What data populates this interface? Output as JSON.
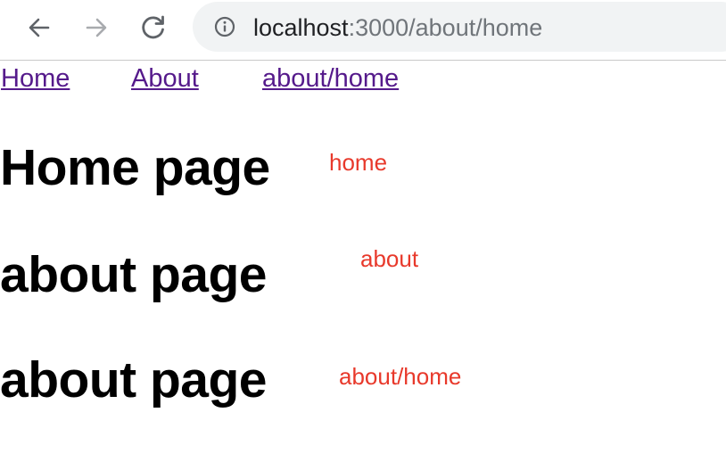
{
  "browser": {
    "url_host": "localhost",
    "url_rest": ":3000/about/home",
    "icons": {
      "back": "arrow-left-icon",
      "forward": "arrow-right-icon",
      "reload": "reload-icon",
      "info": "info-circle-icon"
    },
    "colors": {
      "toolbar_icon": "#5f6368",
      "forward_disabled": "#a8abae",
      "omnibox_bg": "#f1f3f4"
    }
  },
  "nav": {
    "links": [
      {
        "label": "Home"
      },
      {
        "label": "About"
      },
      {
        "label": "about/home"
      }
    ],
    "link_color": "#551a8b"
  },
  "routes": [
    {
      "heading": "Home page",
      "label": "home"
    },
    {
      "heading": "about page",
      "label": "about"
    },
    {
      "heading": "about page",
      "label": "about/home"
    }
  ],
  "accent_color": "#e8392b"
}
